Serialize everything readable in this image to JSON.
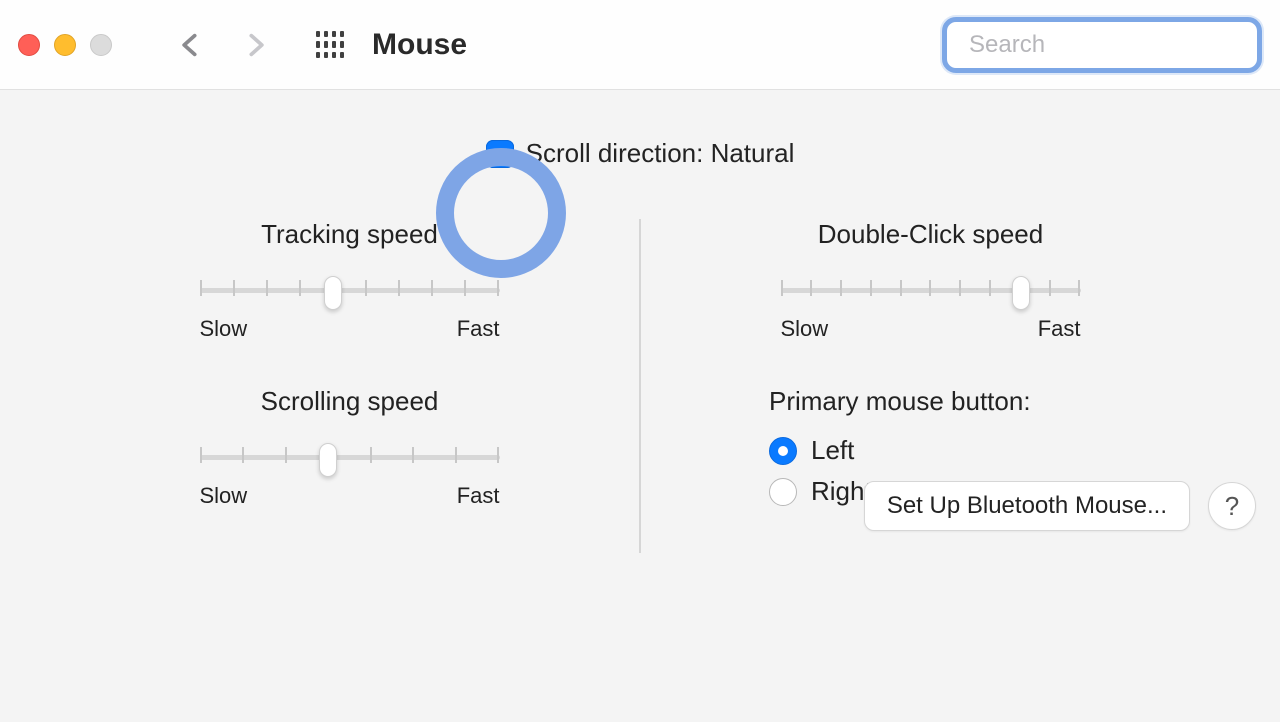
{
  "toolbar": {
    "title": "Mouse",
    "search_placeholder": "Search"
  },
  "settings": {
    "scroll_natural": {
      "label": "Scroll direction: Natural",
      "checked": true
    },
    "tracking": {
      "title": "Tracking speed",
      "min_label": "Slow",
      "max_label": "Fast",
      "ticks": 10,
      "value_index": 4
    },
    "scrolling": {
      "title": "Scrolling speed",
      "min_label": "Slow",
      "max_label": "Fast",
      "ticks": 8,
      "value_index": 3
    },
    "double_click": {
      "title": "Double-Click speed",
      "min_label": "Slow",
      "max_label": "Fast",
      "ticks": 11,
      "value_index": 8
    },
    "primary_button": {
      "title": "Primary mouse button:",
      "options": [
        "Left",
        "Right"
      ],
      "selected": "Left"
    }
  },
  "footer": {
    "bluetooth_button": "Set Up Bluetooth Mouse...",
    "help_label": "?"
  }
}
